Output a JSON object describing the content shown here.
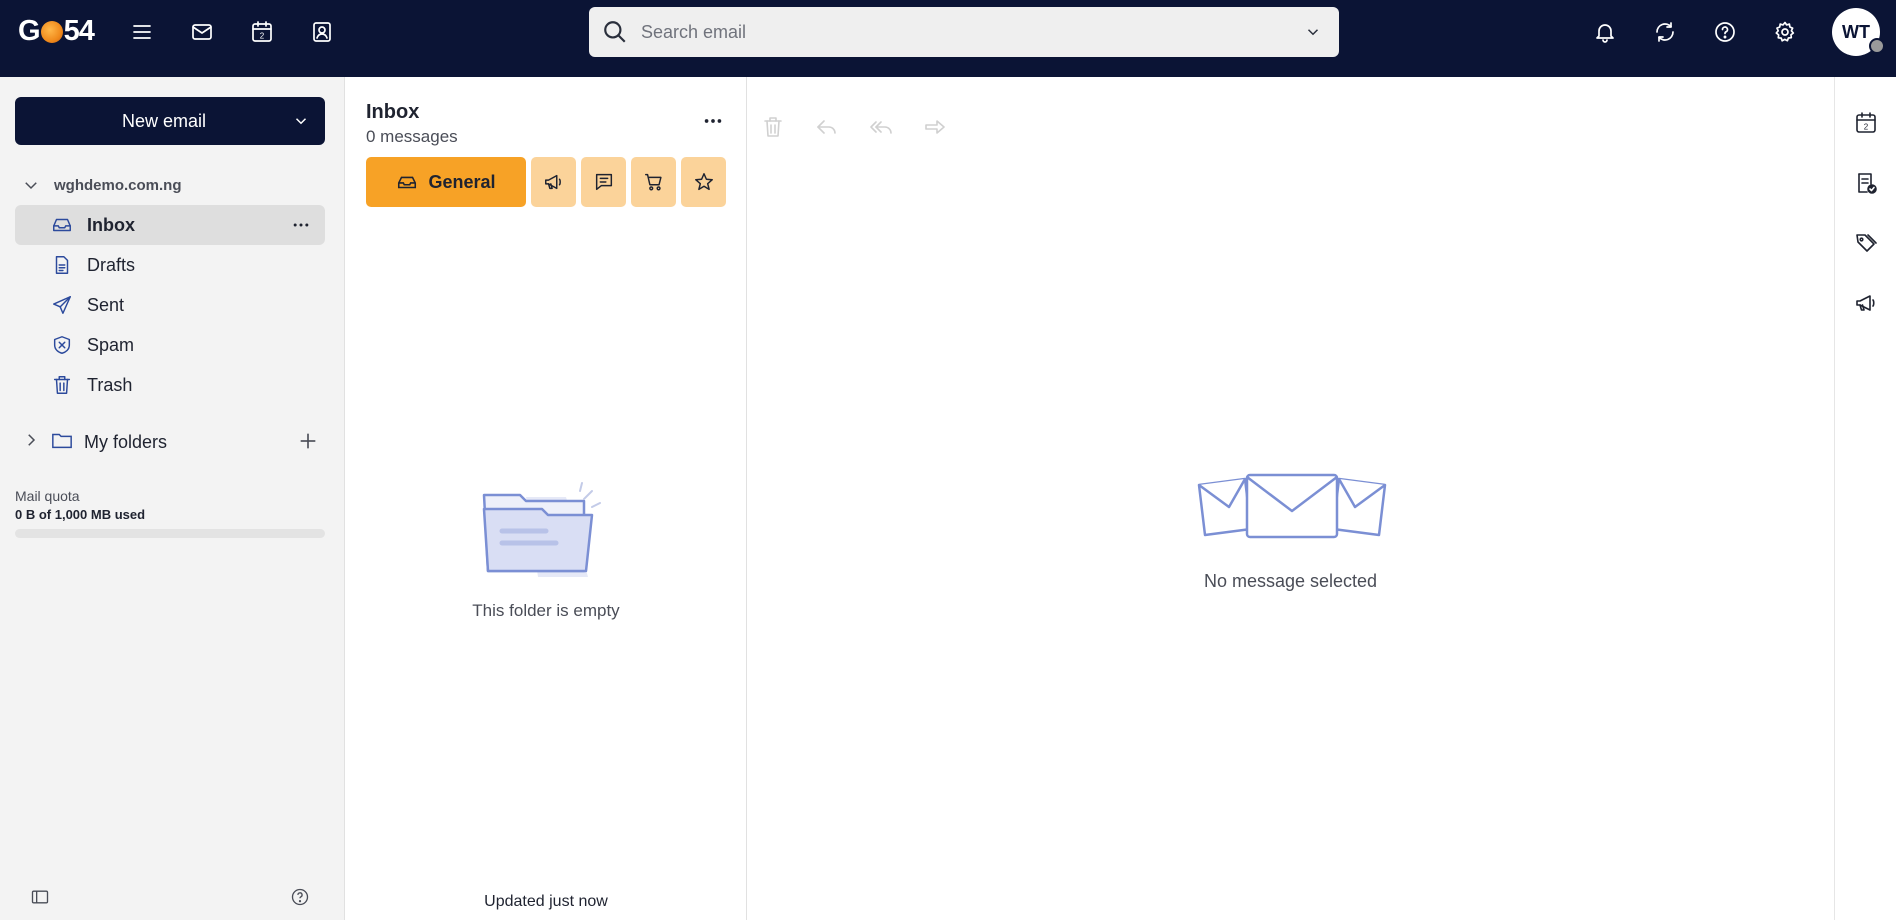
{
  "app": {
    "logo_text_left": "G",
    "logo_text_right": "54"
  },
  "topbar": {
    "icons": [
      "menu-icon",
      "mail-icon",
      "calendar-icon",
      "contacts-icon",
      "bell-icon",
      "sync-icon",
      "help-icon",
      "gear-icon"
    ],
    "calendar_day": "2",
    "search": {
      "placeholder": "Search email",
      "value": ""
    },
    "avatar_initials": "WT"
  },
  "sidebar": {
    "new_email_label": "New email",
    "account_name": "wghdemo.com.ng",
    "folders": [
      {
        "label": "Inbox",
        "icon": "inbox-icon",
        "active": true
      },
      {
        "label": "Drafts",
        "icon": "drafts-icon",
        "active": false
      },
      {
        "label": "Sent",
        "icon": "sent-icon",
        "active": false
      },
      {
        "label": "Spam",
        "icon": "spam-icon",
        "active": false
      },
      {
        "label": "Trash",
        "icon": "trash-icon",
        "active": false
      }
    ],
    "my_folders_label": "My folders",
    "quota": {
      "label": "Mail quota",
      "used_text": "0 B of 1,000 MB used",
      "fraction": 0
    }
  },
  "list": {
    "title": "Inbox",
    "count_text": "0 messages",
    "tabs": [
      {
        "label": "General",
        "icon": "inbox-tray-icon",
        "selected": true
      },
      {
        "icon": "megaphone-icon"
      },
      {
        "icon": "chat-icon"
      },
      {
        "icon": "cart-icon"
      },
      {
        "icon": "star-icon"
      }
    ],
    "empty_text": "This folder is empty",
    "updated_text": "Updated just now"
  },
  "reader": {
    "toolbar_icons": [
      "trash-icon",
      "reply-icon",
      "reply-all-icon",
      "forward-icon"
    ],
    "empty_text": "No message selected"
  },
  "rail": {
    "icons": [
      "calendar-icon",
      "tasks-icon",
      "tags-icon",
      "megaphone-icon"
    ],
    "calendar_day": "2"
  },
  "colors": {
    "topbar_bg": "#0b1435",
    "accent_orange": "#f7a226",
    "tab_light_orange": "#fbd39a",
    "icon_blue": "#2c4a9c",
    "sidebar_bg": "#f3f3f3",
    "active_folder_bg": "#dedede"
  }
}
